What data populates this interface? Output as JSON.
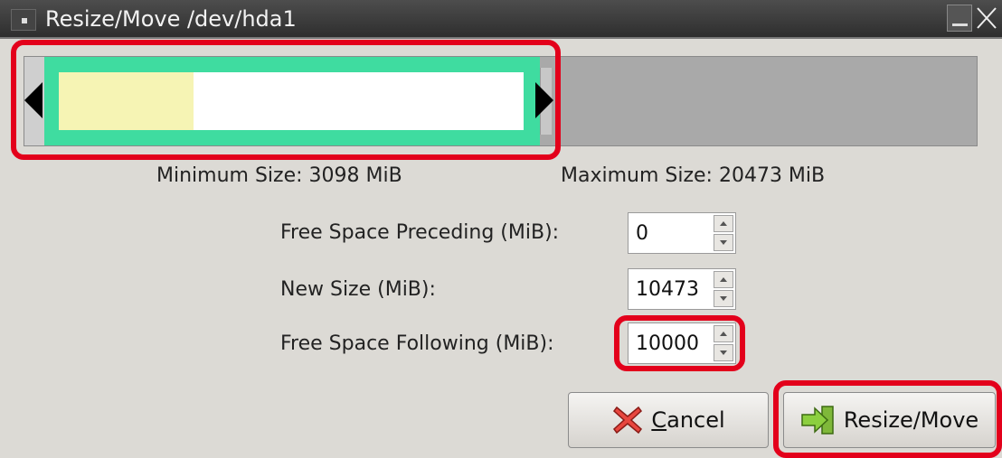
{
  "window": {
    "title": "Resize/Move /dev/hda1"
  },
  "partition_graphic": {
    "used_fraction": 0.29,
    "partition_color": "#3fdca0",
    "used_color": "#f6f4b4",
    "unallocated_color": "#a9a9a9"
  },
  "limits": {
    "minimum": "Minimum Size: 3098 MiB",
    "maximum": "Maximum Size: 20473 MiB"
  },
  "fields": {
    "preceding": {
      "label": "Free Space Preceding (MiB):",
      "value": "0"
    },
    "new_size": {
      "label": "New Size (MiB):",
      "value": "10473"
    },
    "following": {
      "label": "Free Space Following (MiB):",
      "value": "10000"
    }
  },
  "buttons": {
    "cancel": {
      "mnemonic": "C",
      "rest": "ancel",
      "icon": "cancel-icon"
    },
    "resize": {
      "label": "Resize/Move",
      "icon": "resize-move-icon"
    }
  },
  "highlight_color": "#e3001b"
}
